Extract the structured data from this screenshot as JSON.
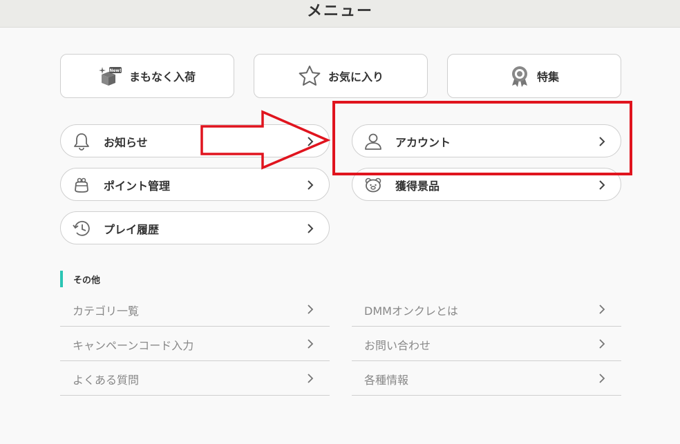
{
  "header": {
    "title": "メニュー"
  },
  "top_buttons": [
    {
      "label": "まもなく入荷",
      "icon": "new-box-icon"
    },
    {
      "label": "お気に入り",
      "icon": "star-icon"
    },
    {
      "label": "特集",
      "icon": "award-ribbon-icon"
    }
  ],
  "menu_left": [
    {
      "label": "お知らせ",
      "icon": "bell-icon"
    },
    {
      "label": "ポイント管理",
      "icon": "coin-purse-icon"
    },
    {
      "label": "プレイ履歴",
      "icon": "history-clock-icon"
    }
  ],
  "menu_right": [
    {
      "label": "アカウント",
      "icon": "user-icon"
    },
    {
      "label": "獲得景品",
      "icon": "bear-face-icon"
    }
  ],
  "other": {
    "title": "その他",
    "left": [
      "カテゴリ一覧",
      "キャンペーンコード入力",
      "よくある質問"
    ],
    "right": [
      "DMMオンクレとは",
      "お問い合わせ",
      "各種情報"
    ]
  },
  "annotation": {
    "color": "#e0141e",
    "arrow": "right-arrow",
    "highlight_target": "アカウント"
  },
  "colors": {
    "accent": "#2bc5b4",
    "header_bg": "#ebebe8",
    "page_bg": "#f9f9f9"
  }
}
